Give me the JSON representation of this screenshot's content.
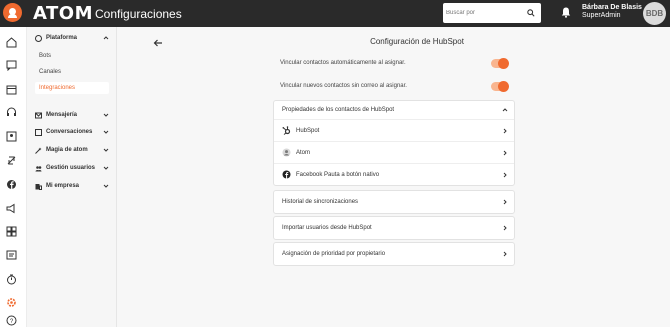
{
  "app": {
    "brand": "ATOM",
    "section": "Configuraciones"
  },
  "search": {
    "placeholder": "Buscar por"
  },
  "user": {
    "name": "Bárbara De Blasis",
    "role": "SuperAdmin",
    "initials": "BDB"
  },
  "rail": {
    "icons": [
      "home-icon",
      "chat-icon",
      "calendar-icon",
      "headset-icon",
      "contacts-icon",
      "block-icon",
      "facebook-icon",
      "megaphone-icon",
      "dashboard-icon",
      "messages-icon",
      "timer-icon",
      "settings-icon",
      "help-icon"
    ]
  },
  "sidebar": {
    "platform": {
      "label": "Plataforma",
      "sub": [
        "Bots",
        "Canales",
        "Integraciones"
      ]
    },
    "items": [
      "Mensajería",
      "Conversaciones",
      "Magia de atom",
      "Gestión usuarios",
      "Mi empresa"
    ]
  },
  "main": {
    "title": "Configuración de HubSpot",
    "toggles": [
      {
        "label": "Vincular contactos automáticamente al asignar.",
        "on": true
      },
      {
        "label": "Vincular nuevos contactos sin correo al asignar.",
        "on": true
      }
    ],
    "properties": {
      "header": "Propiedades de los contactos de HubSpot",
      "rows": [
        "HubSpot",
        "Atom",
        "Facebook Pauta a botón nativo"
      ]
    },
    "links": [
      "Historial de sincronizaciones",
      "Importar usuarios desde HubSpot",
      "Asignación de prioridad por propietario"
    ]
  },
  "colors": {
    "accent": "#f06a2f",
    "topbar": "#2a2a2a"
  }
}
